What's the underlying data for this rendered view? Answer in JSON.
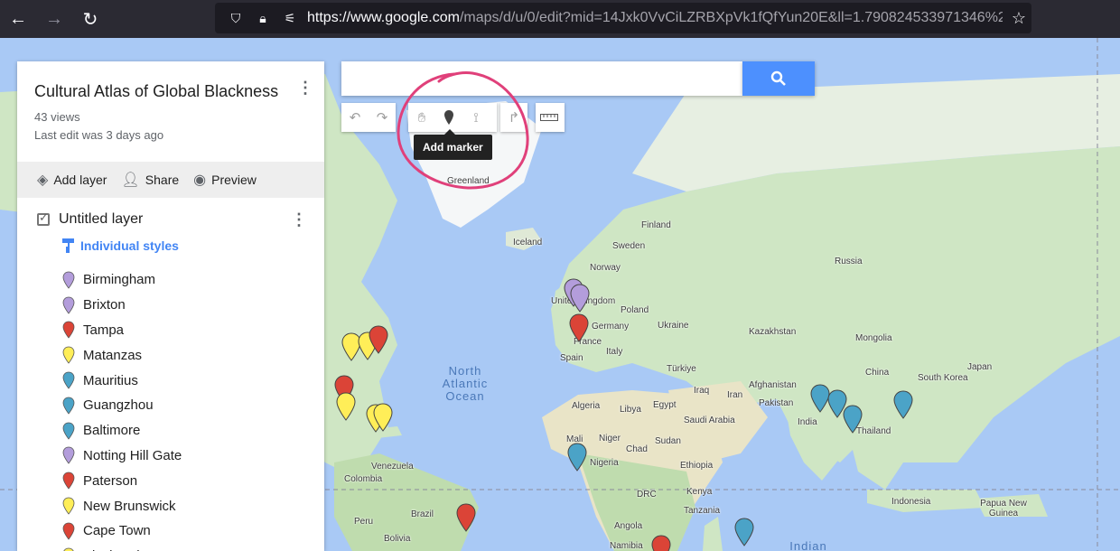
{
  "browser": {
    "url_host": "https://www.google.com",
    "url_rest": "/maps/d/u/0/edit?mid=14Jxk0VvCiLZRBXpVk1fQfYun20E&ll=1.790824533971346%2",
    "back_icon": "arrow-left-icon",
    "forward_icon": "arrow-right-icon",
    "reload_icon": "reload-icon"
  },
  "panel": {
    "title": "Cultural Atlas of Global Blackness",
    "views": "43 views",
    "last_edit": "Last edit was 3 days ago",
    "actions": [
      {
        "label": "Add layer",
        "icon": "layers-icon"
      },
      {
        "label": "Share",
        "icon": "add-person-icon"
      },
      {
        "label": "Preview",
        "icon": "eye-icon"
      }
    ],
    "layer": {
      "name": "Untitled layer",
      "checked": true,
      "style_label": "Individual styles"
    },
    "items": [
      {
        "label": "Birmingham",
        "color": "#b39ddb"
      },
      {
        "label": "Brixton",
        "color": "#b39ddb"
      },
      {
        "label": "Tampa",
        "color": "#db4437"
      },
      {
        "label": "Matanzas",
        "color": "#ffee58"
      },
      {
        "label": "Mauritius",
        "color": "#4ba3c7"
      },
      {
        "label": "Guangzhou",
        "color": "#4ba3c7"
      },
      {
        "label": "Baltimore",
        "color": "#4ba3c7"
      },
      {
        "label": "Notting Hill Gate",
        "color": "#b39ddb"
      },
      {
        "label": "Paterson",
        "color": "#db4437"
      },
      {
        "label": "New Brunswick",
        "color": "#ffee58"
      },
      {
        "label": "Cape Town",
        "color": "#db4437"
      },
      {
        "label": "Pittsburgh",
        "color": "#ffee58"
      }
    ]
  },
  "search": {
    "value": "",
    "placeholder": ""
  },
  "toolbar": {
    "tooltip": "Add marker",
    "tools": [
      "undo-icon",
      "redo-icon",
      "hand-icon",
      "marker-icon",
      "line-icon",
      "directions-icon",
      "ruler-icon"
    ]
  },
  "map": {
    "places": [
      "Greenland",
      "Iceland",
      "Finland",
      "Sweden",
      "Norway",
      "Russia",
      "Poland",
      "Germany",
      "Ukraine",
      "United Kingdom",
      "France",
      "Italy",
      "Spain",
      "Kazakhstan",
      "Mongolia",
      "Türkiye",
      "Afghanistan",
      "China",
      "South Korea",
      "Japan",
      "Iraq",
      "Iran",
      "Pakistan",
      "Egypt",
      "Saudi Arabia",
      "India",
      "Thailand",
      "Algeria",
      "Libya",
      "Mali",
      "Niger",
      "Chad",
      "Sudan",
      "Nigeria",
      "Ethiopia",
      "DRC",
      "Kenya",
      "Tanzania",
      "Angola",
      "Namibia",
      "Indonesia",
      "Papua New Guinea",
      "Venezuela",
      "Colombia",
      "Peru",
      "Brazil",
      "Bolivia"
    ],
    "oceans": [
      "North Atlantic Ocean",
      "Indian Ocean"
    ],
    "pin_colors": {
      "purple": "#b39ddb",
      "red": "#db4437",
      "yellow": "#ffee58",
      "blue": "#4ba3c7"
    }
  }
}
